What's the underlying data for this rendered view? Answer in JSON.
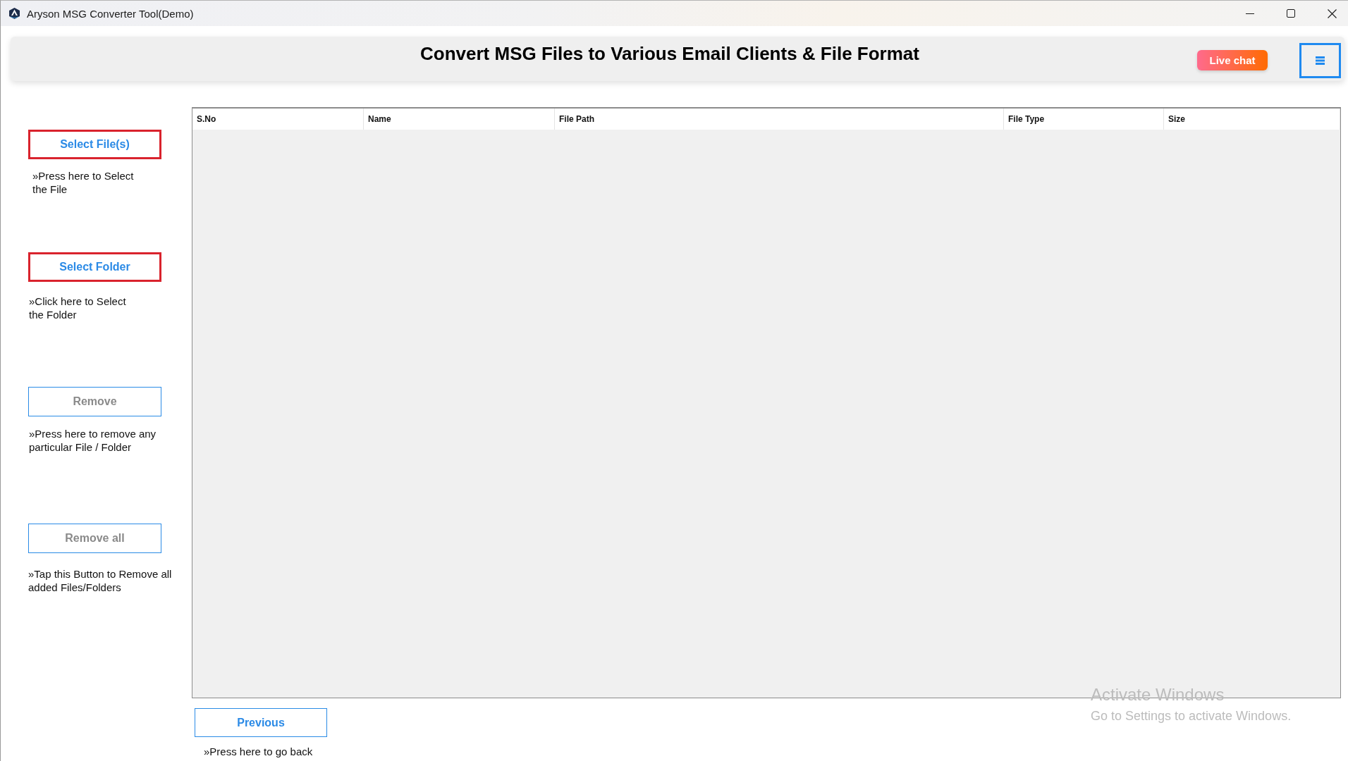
{
  "window": {
    "title": "Aryson MSG Converter Tool(Demo)"
  },
  "header": {
    "title": "Convert MSG Files to Various Email Clients & File Format",
    "live_chat": {
      "label": "Live chat"
    }
  },
  "sidebar": {
    "actions": [
      {
        "label": "Select File(s)",
        "highlighted": true,
        "disabled": false,
        "hint": "»Press here to Select the File"
      },
      {
        "label": "Select Folder",
        "highlighted": true,
        "disabled": false,
        "hint": "»Click here to Select the Folder"
      },
      {
        "label": "Remove",
        "highlighted": false,
        "disabled": true,
        "hint": "»Press here to remove any particular File / Folder"
      },
      {
        "label": "Remove all",
        "highlighted": false,
        "disabled": true,
        "hint": "»Tap this Button to Remove all added Files/Folders"
      }
    ]
  },
  "table": {
    "columns": [
      "S.No",
      "Name",
      "File Path",
      "File Type",
      "Size"
    ]
  },
  "footer": {
    "previous": {
      "label": "Previous",
      "disabled": false
    },
    "hint": "»Press here to go back"
  },
  "activation_notice": {
    "title": "Activate Windows",
    "message": "Go to Settings to activate Windows."
  }
}
